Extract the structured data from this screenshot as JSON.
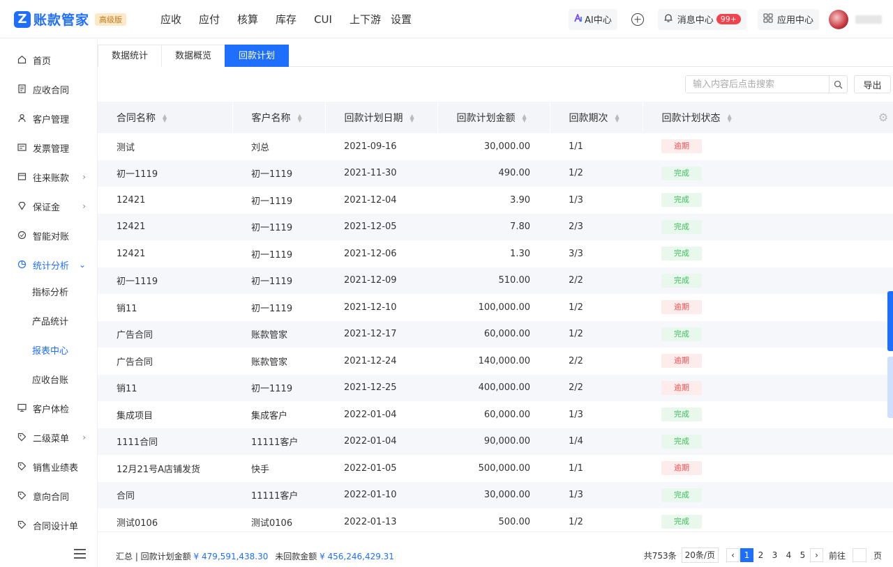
{
  "header": {
    "logo_mark": "Z",
    "app_name": "账款管家",
    "edition": "高级版",
    "nav": [
      "应收",
      "应付",
      "核算",
      "库存",
      "CUI",
      "上下游",
      "设置"
    ],
    "ai_label": "AI中心",
    "msg_label": "消息中心",
    "msg_badge": "99+",
    "apps_label": "应用中心"
  },
  "sidebar": {
    "items": [
      {
        "label": "首页",
        "icon": "home-icon"
      },
      {
        "label": "应收合同",
        "icon": "document-icon"
      },
      {
        "label": "客户管理",
        "icon": "user-icon"
      },
      {
        "label": "发票管理",
        "icon": "invoice-icon"
      },
      {
        "label": "往来账款",
        "icon": "ledger-icon"
      },
      {
        "label": "保证金",
        "icon": "diamond-icon"
      },
      {
        "label": "智能对账",
        "icon": "reconcile-icon"
      },
      {
        "label": "统计分析",
        "icon": "chart-icon"
      },
      {
        "label": "客户体检",
        "icon": "monitor-icon"
      },
      {
        "label": "二级菜单",
        "icon": "tag-icon"
      },
      {
        "label": "销售业绩表",
        "icon": "tag-icon"
      },
      {
        "label": "意向合同",
        "icon": "tag-icon"
      },
      {
        "label": "合同设计单",
        "icon": "tag-icon"
      }
    ],
    "sub_items": [
      "指标分析",
      "产品统计",
      "报表中心",
      "应收台账"
    ]
  },
  "tabs": [
    "数据统计",
    "数据概览",
    "回款计划"
  ],
  "search": {
    "placeholder": "输入内容后点击搜索"
  },
  "export_label": "导出",
  "table": {
    "columns": [
      "合同名称",
      "客户名称",
      "回款计划日期",
      "回款计划金额",
      "回款期次",
      "回款计划状态"
    ],
    "rows": [
      [
        "测试",
        "刘总",
        "2021-09-16",
        "30,000.00",
        "1/1",
        "逾期"
      ],
      [
        "初一1119",
        "初一1119",
        "2021-11-30",
        "490.00",
        "1/2",
        "完成"
      ],
      [
        "12421",
        "初一1119",
        "2021-12-04",
        "3.90",
        "1/3",
        "完成"
      ],
      [
        "12421",
        "初一1119",
        "2021-12-05",
        "7.80",
        "2/3",
        "完成"
      ],
      [
        "12421",
        "初一1119",
        "2021-12-06",
        "1.30",
        "3/3",
        "完成"
      ],
      [
        "初一1119",
        "初一1119",
        "2021-12-09",
        "510.00",
        "2/2",
        "完成"
      ],
      [
        "销11",
        "初一1119",
        "2021-12-10",
        "100,000.00",
        "1/2",
        "逾期"
      ],
      [
        "广告合同",
        "账款管家",
        "2021-12-17",
        "60,000.00",
        "1/2",
        "完成"
      ],
      [
        "广告合同",
        "账款管家",
        "2021-12-24",
        "140,000.00",
        "2/2",
        "逾期"
      ],
      [
        "销11",
        "初一1119",
        "2021-12-25",
        "400,000.00",
        "2/2",
        "逾期"
      ],
      [
        "集成项目",
        "集成客户",
        "2022-01-04",
        "60,000.00",
        "1/3",
        "完成"
      ],
      [
        "1111合同",
        "11111客户",
        "2022-01-04",
        "90,000.00",
        "1/4",
        "完成"
      ],
      [
        "12月21号A店铺发货",
        "快手",
        "2022-01-05",
        "500,000.00",
        "1/1",
        "逾期"
      ],
      [
        "合同",
        "11111客户",
        "2022-01-10",
        "30,000.00",
        "1/3",
        "完成"
      ],
      [
        "测试0106",
        "测试0106",
        "2022-01-13",
        "500.00",
        "1/2",
        "完成"
      ]
    ]
  },
  "summary": {
    "prefix": "汇总 | 回款计划金额",
    "plan_amount": "¥ 479,591,438.30",
    "unpaid_label": "未回款金额",
    "unpaid_amount": "¥ 456,246,429.31"
  },
  "pager": {
    "total": "共753条",
    "page_size": "20条/页",
    "pages": [
      "1",
      "2",
      "3",
      "4",
      "5"
    ],
    "current": "1",
    "goto_label": "前往",
    "page_suffix": "页"
  }
}
